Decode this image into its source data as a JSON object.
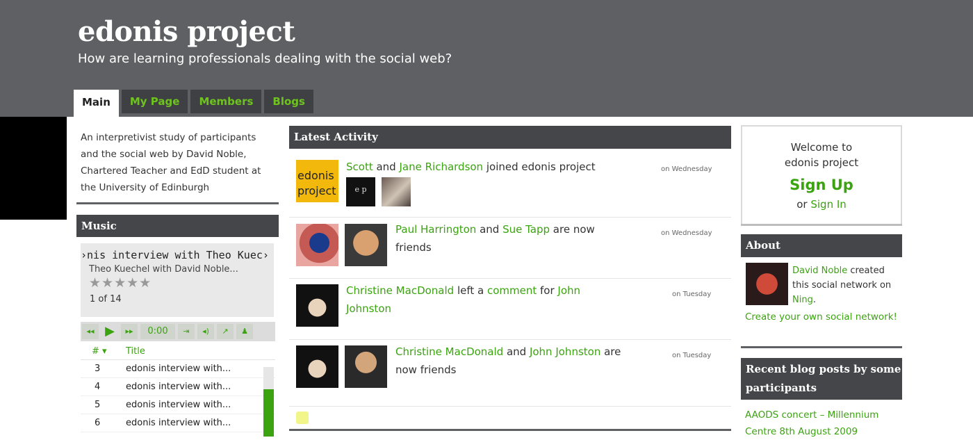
{
  "site": {
    "title": "edonis project",
    "tagline": "How are learning professionals dealing with the social web?"
  },
  "tabs": [
    {
      "label": "Main",
      "active": true
    },
    {
      "label": "My Page",
      "active": false
    },
    {
      "label": "Members",
      "active": false
    },
    {
      "label": "Blogs",
      "active": false
    }
  ],
  "intro": "An interpretivist study of participants and the social web by David Noble, Chartered Teacher and EdD student at the University of Edinburgh",
  "music": {
    "heading": "Music",
    "track_title": "›nis interview with Theo Kuec›",
    "track_subtitle": "Theo Kuechel with David Noble...",
    "rating_stars": "★★★★★",
    "track_count": "1 of 14",
    "time": "0:00",
    "playlist_headers": {
      "num": "# ▾",
      "title": "Title"
    },
    "playlist": [
      {
        "num": "3",
        "title": "edonis interview with..."
      },
      {
        "num": "4",
        "title": "edonis interview with..."
      },
      {
        "num": "5",
        "title": "edonis interview with..."
      },
      {
        "num": "6",
        "title": "edonis interview with..."
      }
    ],
    "scroll_position": 0.33
  },
  "activity": {
    "heading": "Latest Activity",
    "items": [
      {
        "parts": [
          {
            "text": "Scott",
            "link": true
          },
          {
            "text": " and ",
            "link": false
          },
          {
            "text": "Jane Richardson",
            "link": true
          },
          {
            "text": " joined edonis project",
            "link": false
          }
        ],
        "time": "on Wednesday"
      },
      {
        "parts": [
          {
            "text": "Paul Harrington",
            "link": true
          },
          {
            "text": " and ",
            "link": false
          },
          {
            "text": "Sue Tapp",
            "link": true
          },
          {
            "text": " are now friends",
            "link": false
          }
        ],
        "time": "on Wednesday"
      },
      {
        "parts": [
          {
            "text": "Christine MacDonald",
            "link": true
          },
          {
            "text": " left a ",
            "link": false
          },
          {
            "text": "comment",
            "link": true
          },
          {
            "text": " for ",
            "link": false
          },
          {
            "text": "John Johnston",
            "link": true
          }
        ],
        "time": "on Tuesday"
      },
      {
        "parts": [
          {
            "text": "Christine MacDonald",
            "link": true
          },
          {
            "text": " and ",
            "link": false
          },
          {
            "text": "John Johnston",
            "link": true
          },
          {
            "text": " are now friends",
            "link": false
          }
        ],
        "time": "on Tuesday"
      }
    ],
    "logo_text": "edonis project",
    "small_logo_text": "e p"
  },
  "welcome": {
    "line1": "Welcome to",
    "line2": "edonis project",
    "signup": "Sign Up",
    "or": "or",
    "signin": "Sign In"
  },
  "about": {
    "heading": "About",
    "creator": "David Noble",
    "created_text": " created this social network on ",
    "ning": "Ning",
    "period": ".",
    "create_link": "Create your own social network!"
  },
  "recent": {
    "heading": "Recent blog posts by some participants",
    "first_post": "AAODS concert – Millennium Centre 8th August 2009"
  },
  "colors": {
    "header": "#5f6063",
    "panel_head": "#45464a",
    "link_green": "#3aa30f",
    "tab_text": "#6fc31f"
  }
}
